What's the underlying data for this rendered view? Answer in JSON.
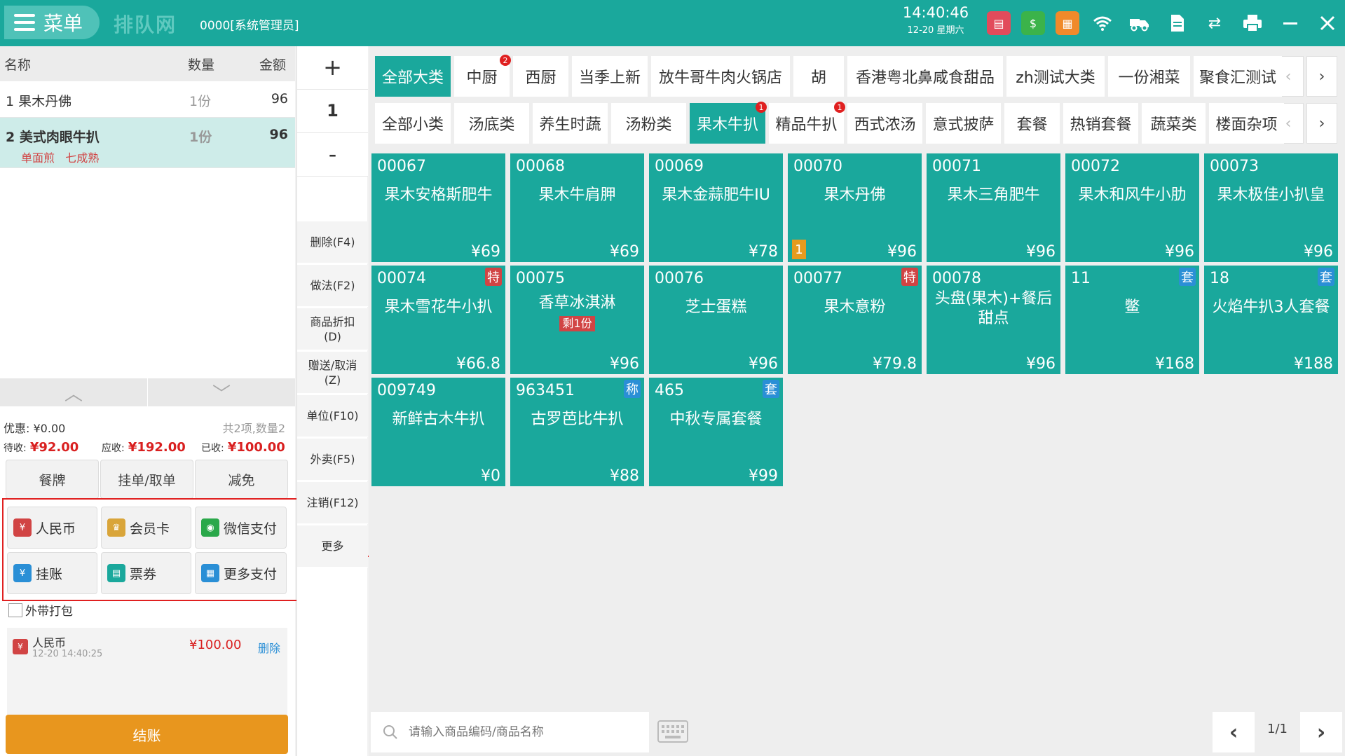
{
  "topbar": {
    "menu_label": "菜单",
    "logo_text": "排队网",
    "operator": "0000[系统管理员]",
    "time": "14:40:46",
    "date": "12-20 星期六",
    "icons": [
      "shop-icon",
      "money-bag-icon",
      "calendar-icon",
      "wifi-icon",
      "delivery-icon",
      "document-icon",
      "sync-icon",
      "printer-icon",
      "minimize-icon",
      "close-icon"
    ]
  },
  "order": {
    "headers": {
      "name": "名称",
      "qty": "数量",
      "amount": "金额"
    },
    "items": [
      {
        "name": "1 果木丹佛",
        "qty": "1份",
        "amount": "96",
        "note": ""
      },
      {
        "name": "2 美式肉眼牛扒",
        "qty": "1份",
        "amount": "96",
        "note": "单面煎   七成熟"
      }
    ]
  },
  "summary": {
    "discount_label": "优惠:",
    "discount_value": "¥0.00",
    "count_text": "共2项,数量2",
    "pending_label": "待收:",
    "pending_value": "¥92.00",
    "receivable_label": "应收:",
    "receivable_value": "¥192.00",
    "received_label": "已收:",
    "received_value": "¥100.00"
  },
  "actions": {
    "table_card": "餐牌",
    "hold_order": "挂单/取单",
    "reduce": "减免"
  },
  "payments": [
    {
      "label": "人民币",
      "icon": "rmb-icon",
      "color": "#d14444"
    },
    {
      "label": "会员卡",
      "icon": "member-card-icon",
      "color": "#d9a53a"
    },
    {
      "label": "微信支付",
      "icon": "wechat-icon",
      "color": "#2aa84a"
    },
    {
      "label": "挂账",
      "icon": "credit-icon",
      "color": "#2a8fd6"
    },
    {
      "label": "票券",
      "icon": "ticket-icon",
      "color": "#1aa89c"
    },
    {
      "label": "更多支付",
      "icon": "more-pay-icon",
      "color": "#2a8fd6"
    }
  ],
  "takeaway_label": "外带打包",
  "paid_record": {
    "method": "人民币",
    "time": "12-20 14:40:25",
    "amount": "¥100.00",
    "delete": "删除"
  },
  "checkout_label": "结账",
  "side": {
    "plus": "+",
    "qty": "1",
    "minus": "-",
    "buttons": [
      "删除(F4)",
      "做法(F2)",
      "商品折扣\n(D)",
      "赠送/取消\n(Z)",
      "单位(F10)",
      "外卖(F5)",
      "注销(F12)",
      "更多"
    ]
  },
  "categories": [
    {
      "label": "全部大类",
      "active": true,
      "badge": ""
    },
    {
      "label": "中厨",
      "active": false,
      "badge": "2"
    },
    {
      "label": "西厨",
      "active": false,
      "badge": ""
    },
    {
      "label": "当季上新",
      "active": false,
      "badge": ""
    },
    {
      "label": "放牛哥牛肉火锅店",
      "active": false,
      "badge": ""
    },
    {
      "label": "胡",
      "active": false,
      "badge": ""
    },
    {
      "label": "香港粤北鼻咸食甜品",
      "active": false,
      "badge": ""
    },
    {
      "label": "zh测试大类",
      "active": false,
      "badge": ""
    },
    {
      "label": "一份湘菜",
      "active": false,
      "badge": ""
    },
    {
      "label": "聚食汇测试",
      "active": false,
      "badge": ""
    }
  ],
  "subcategories": [
    {
      "label": "全部小类",
      "active": false,
      "badge": ""
    },
    {
      "label": "汤底类",
      "active": false,
      "badge": ""
    },
    {
      "label": "养生时蔬",
      "active": false,
      "badge": ""
    },
    {
      "label": "汤粉类",
      "active": false,
      "badge": ""
    },
    {
      "label": "果木牛扒",
      "active": true,
      "badge": "1"
    },
    {
      "label": "精品牛扒",
      "active": false,
      "badge": "1"
    },
    {
      "label": "西式浓汤",
      "active": false,
      "badge": ""
    },
    {
      "label": "意式披萨",
      "active": false,
      "badge": ""
    },
    {
      "label": "套餐",
      "active": false,
      "badge": ""
    },
    {
      "label": "热销套餐",
      "active": false,
      "badge": ""
    },
    {
      "label": "蔬菜类",
      "active": false,
      "badge": ""
    },
    {
      "label": "楼面杂项",
      "active": false,
      "badge": ""
    }
  ],
  "products": [
    {
      "code": "00067",
      "name": "果木安格斯肥牛",
      "price": "¥69",
      "tag": "",
      "count": "",
      "remain": ""
    },
    {
      "code": "00068",
      "name": "果木牛肩胛",
      "price": "¥69",
      "tag": "",
      "count": "",
      "remain": ""
    },
    {
      "code": "00069",
      "name": "果木金蒜肥牛IU",
      "price": "¥78",
      "tag": "",
      "count": "",
      "remain": ""
    },
    {
      "code": "00070",
      "name": "果木丹佛",
      "price": "¥96",
      "tag": "",
      "count": "1",
      "remain": ""
    },
    {
      "code": "00071",
      "name": "果木三角肥牛",
      "price": "¥96",
      "tag": "",
      "count": "",
      "remain": ""
    },
    {
      "code": "00072",
      "name": "果木和风牛小肋",
      "price": "¥96",
      "tag": "",
      "count": "",
      "remain": ""
    },
    {
      "code": "00073",
      "name": "果木极佳小扒皇",
      "price": "¥96",
      "tag": "",
      "count": "",
      "remain": ""
    },
    {
      "code": "00074",
      "name": "果木雪花牛小扒",
      "price": "¥66.8",
      "tag": "特",
      "count": "",
      "remain": ""
    },
    {
      "code": "00075",
      "name": "香草冰淇淋",
      "price": "¥96",
      "tag": "",
      "count": "",
      "remain": "剩1份"
    },
    {
      "code": "00076",
      "name": "芝士蛋糕",
      "price": "¥96",
      "tag": "",
      "count": "",
      "remain": ""
    },
    {
      "code": "00077",
      "name": "果木意粉",
      "price": "¥79.8",
      "tag": "特",
      "count": "",
      "remain": ""
    },
    {
      "code": "00078",
      "name": "头盘(果木)+餐后甜点",
      "price": "¥96",
      "tag": "",
      "count": "",
      "remain": ""
    },
    {
      "code": "11",
      "name": "鳖",
      "price": "¥168",
      "tag": "套",
      "count": "",
      "remain": ""
    },
    {
      "code": "18",
      "name": "火焰牛扒3人套餐",
      "price": "¥188",
      "tag": "套",
      "count": "",
      "remain": ""
    },
    {
      "code": "009749",
      "name": "新鲜古木牛扒",
      "price": "¥0",
      "tag": "",
      "count": "",
      "remain": ""
    },
    {
      "code": "963451",
      "name": "古罗芭比牛扒",
      "price": "¥88",
      "tag": "称",
      "count": "",
      "remain": ""
    },
    {
      "code": "465",
      "name": "中秋专属套餐",
      "price": "¥99",
      "tag": "套",
      "count": "",
      "remain": ""
    }
  ],
  "search": {
    "placeholder": "请输入商品编码/商品名称"
  },
  "pager": {
    "text": "1/1"
  },
  "colors": {
    "primary": "#1aa89c",
    "accent": "#e8961e",
    "price_red": "#d92020",
    "tag_red": "#d14444",
    "tag_blue": "#2a8fd6"
  }
}
